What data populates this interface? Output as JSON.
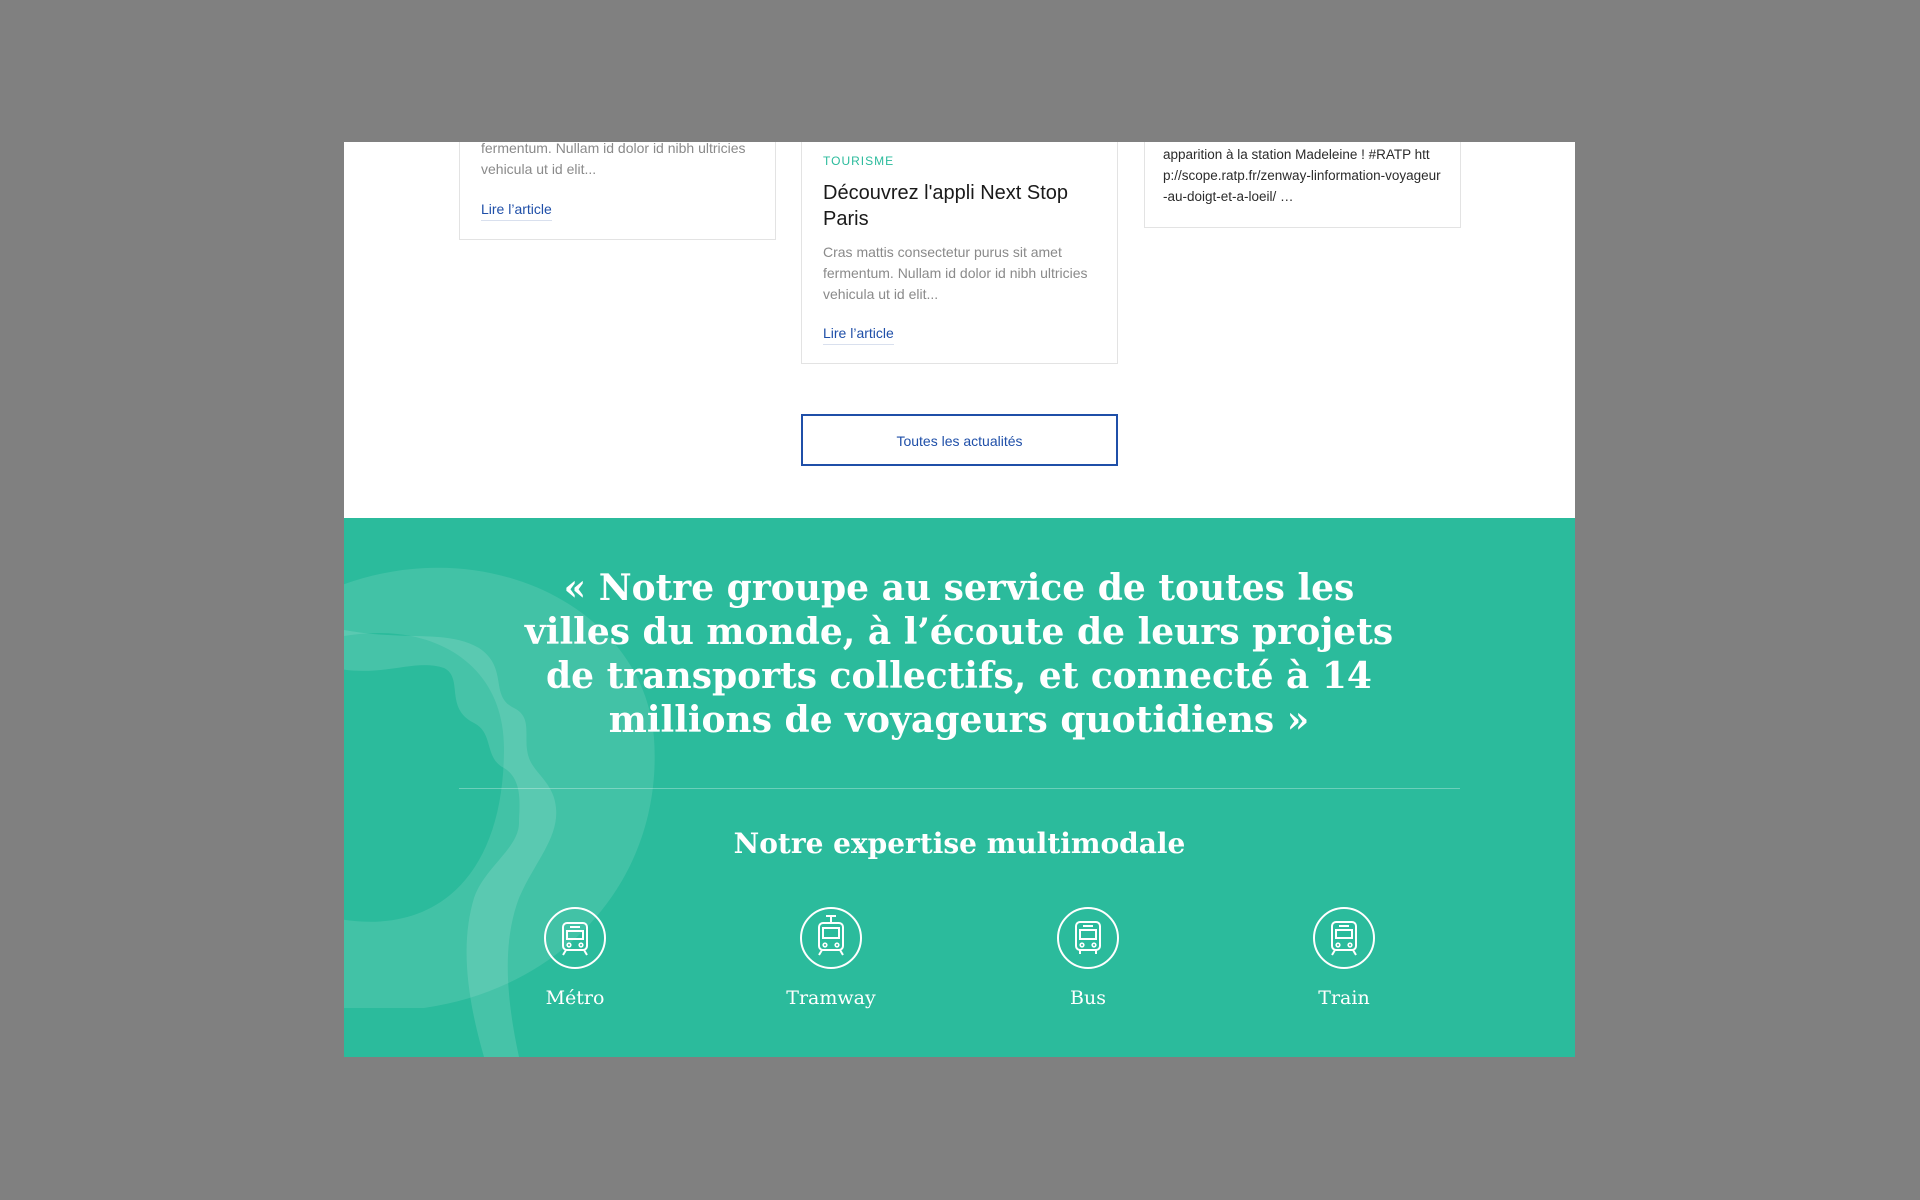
{
  "news": {
    "cards": [
      {
        "excerpt": "fermentum. Nullam id dolor id nibh ultricies vehicula ut id elit...",
        "link_label": "Lire l’article"
      },
      {
        "category": "TOURISME",
        "title": "Découvrez l'appli Next Stop Paris",
        "excerpt": "Cras mattis consectetur purus sit amet fermentum. Nullam id dolor id nibh ultricies vehicula ut id elit...",
        "link_label": "Lire l’article"
      },
      {
        "tweet": "apparition à la station Madeleine ! #RATP http://scope.ratp.fr/zenway-linformation-voyageur-au-doigt-et-a-loeil/ …"
      }
    ],
    "all_news_label": "Toutes les actualités"
  },
  "quote": "« Notre groupe au service de toutes les villes du monde, à l’écoute de leurs projets de transports collectifs, et connecté à 14 millions de voyageurs quotidiens »",
  "expertise": {
    "title": "Notre expertise multimodale",
    "modes": [
      {
        "label": "Métro",
        "icon": "metro-icon"
      },
      {
        "label": "Tramway",
        "icon": "tramway-icon"
      },
      {
        "label": "Bus",
        "icon": "bus-icon"
      },
      {
        "label": "Train",
        "icon": "train-icon"
      }
    ]
  },
  "colors": {
    "accent_green": "#2bbb9c",
    "link_blue": "#1f4fa8",
    "backdrop_gray": "#808080"
  }
}
